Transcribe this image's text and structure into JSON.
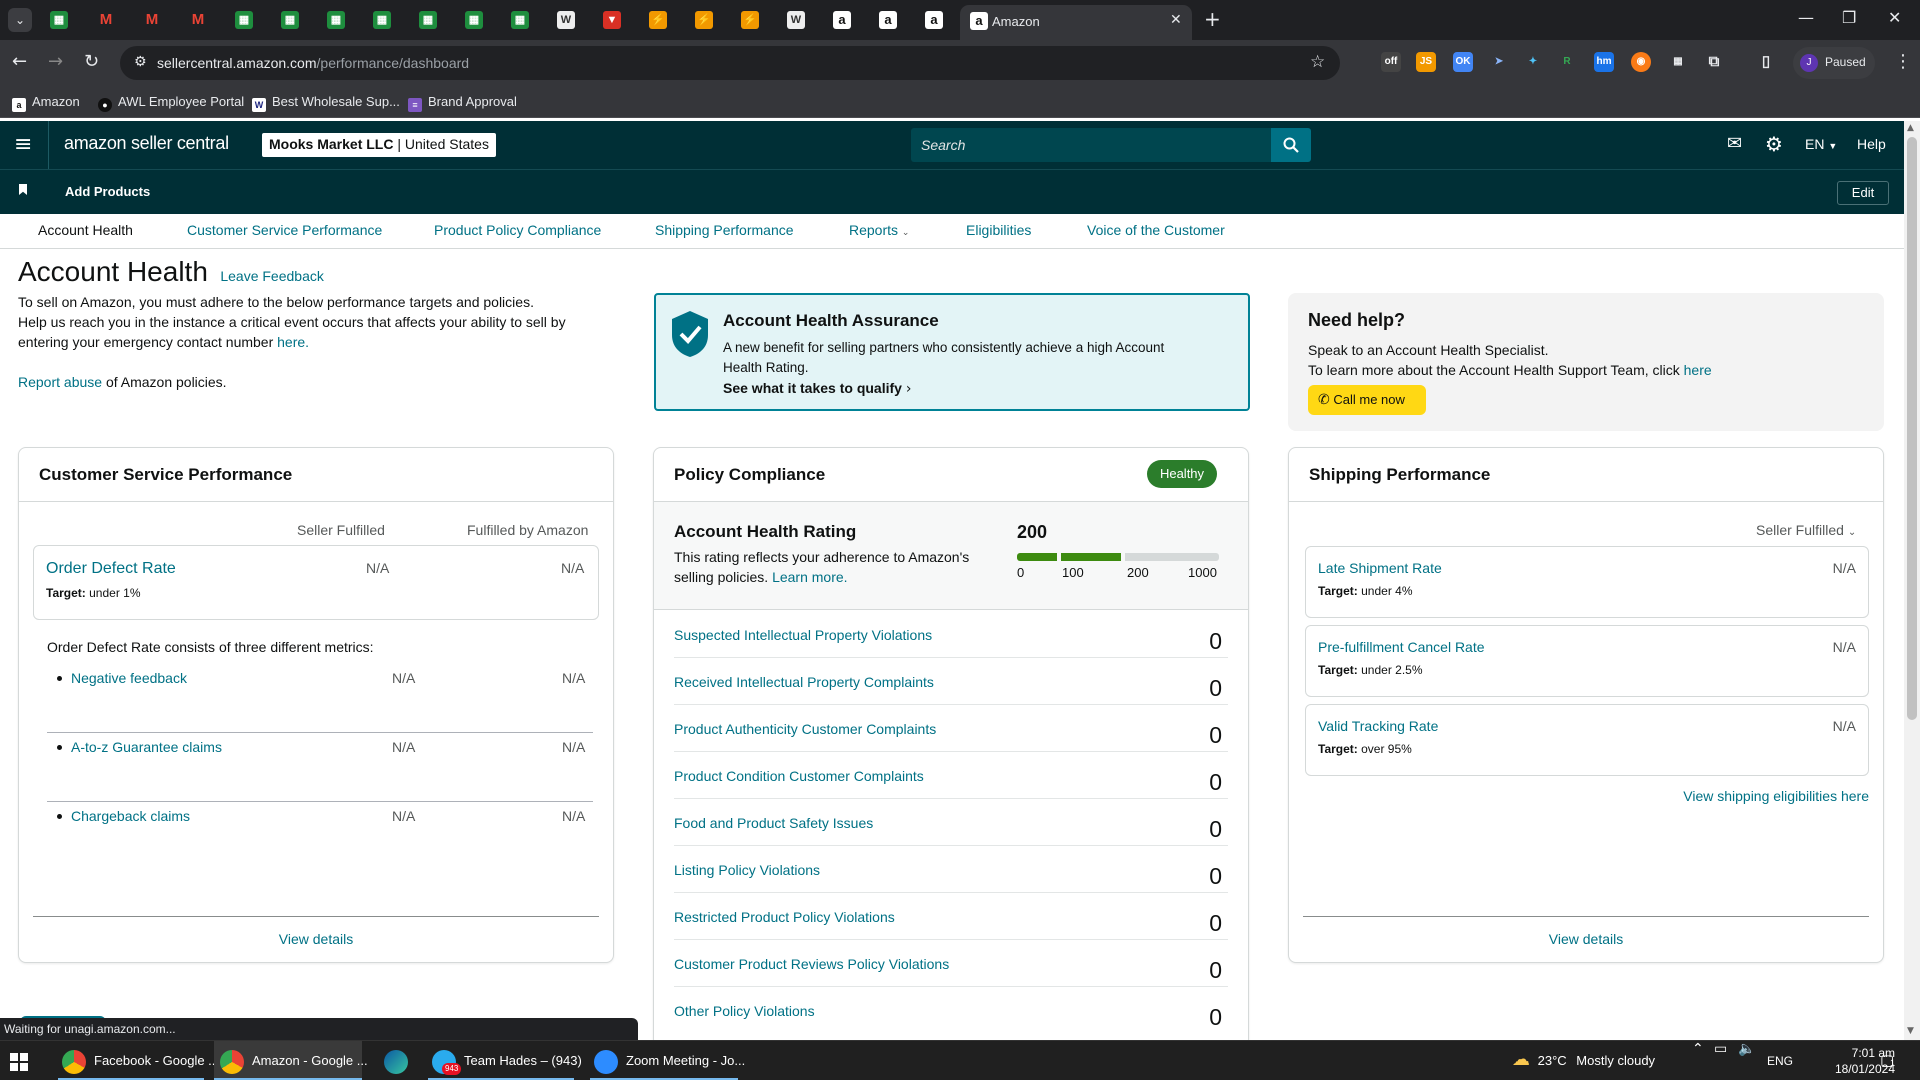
{
  "browser": {
    "active_tab_title": "Amazon",
    "url_host": "sellercentral.amazon.com",
    "url_path": "/performance/dashboard",
    "profile_status": "Paused",
    "profile_initial": "J",
    "tab_icons": [
      "sheets-icon",
      "gmail-icon",
      "gmail-icon",
      "gmail-icon",
      "sheets-icon",
      "sheets-icon",
      "sheets-icon",
      "sheets-icon",
      "sheets-icon",
      "sheets-icon",
      "sheets-icon",
      "doc-icon",
      "red-icon",
      "orange-icon",
      "orange-icon",
      "orange-icon",
      "wsj-icon",
      "amazon-icon",
      "amazon-icon",
      "amazon-icon"
    ],
    "bookmarks": [
      "Amazon",
      "AWL Employee Portal",
      "Best Wholesale Sup...",
      "Brand Approval"
    ],
    "status_text": "Waiting for unagi.amazon.com..."
  },
  "header": {
    "logo": "amazon seller central",
    "store_name": "Mooks Market LLC",
    "store_region": "United States",
    "search_placeholder": "Search",
    "lang": "EN",
    "help": "Help",
    "add_products": "Add Products",
    "edit": "Edit"
  },
  "subnav": [
    "Account Health",
    "Customer Service Performance",
    "Product Policy Compliance",
    "Shipping Performance",
    "Reports",
    "Eligibilities",
    "Voice of the Customer"
  ],
  "intro": {
    "title": "Account Health",
    "feedback": "Leave Feedback",
    "line1": "To sell on Amazon, you must adhere to the below performance targets and policies.",
    "line2": "Help us reach you in the instance a critical event occurs that affects your ability to sell by",
    "line3": "entering your emergency contact number",
    "here": "here.",
    "report_link": "Report abuse",
    "report_text": "of Amazon policies."
  },
  "assurance": {
    "title": "Account Health Assurance",
    "text1": "A new benefit for selling partners who consistently achieve a high Account",
    "text2": "Health Rating.",
    "cta": "See what it takes to qualify"
  },
  "help": {
    "title": "Need help?",
    "line1": "Speak to an Account Health Specialist.",
    "line2": "To learn more about the Account Health Support Team, click",
    "here": "here",
    "button": "Call me now"
  },
  "csp": {
    "title": "Customer Service Performance",
    "col1": "Seller Fulfilled",
    "col2": "Fulfilled by Amazon",
    "odr_label": "Order Defect Rate",
    "odr_target_label": "Target:",
    "odr_target": "under 1%",
    "odr_v1": "N/A",
    "odr_v2": "N/A",
    "consists": "Order Defect Rate consists of three different metrics:",
    "metrics": [
      {
        "label": "Negative feedback",
        "v1": "N/A",
        "v2": "N/A"
      },
      {
        "label": "A-to-z Guarantee claims",
        "v1": "N/A",
        "v2": "N/A"
      },
      {
        "label": "Chargeback claims",
        "v1": "N/A",
        "v2": "N/A"
      }
    ],
    "view_details": "View details"
  },
  "policy": {
    "title": "Policy Compliance",
    "badge": "Healthy",
    "ahr_title": "Account Health Rating",
    "ahr_desc1": "This rating reflects your adherence to Amazon's",
    "ahr_desc2": "selling policies.",
    "learn_more": "Learn more.",
    "rating": "200",
    "rating_value": 200,
    "scale": [
      "0",
      "100",
      "200",
      "1000"
    ],
    "rows": [
      {
        "label": "Suspected Intellectual Property Violations",
        "count": "0"
      },
      {
        "label": "Received Intellectual Property Complaints",
        "count": "0"
      },
      {
        "label": "Product Authenticity Customer Complaints",
        "count": "0"
      },
      {
        "label": "Product Condition Customer Complaints",
        "count": "0"
      },
      {
        "label": "Food and Product Safety Issues",
        "count": "0"
      },
      {
        "label": "Listing Policy Violations",
        "count": "0"
      },
      {
        "label": "Restricted Product Policy Violations",
        "count": "0"
      },
      {
        "label": "Customer Product Reviews Policy Violations",
        "count": "0"
      },
      {
        "label": "Other Policy Violations",
        "count": "0"
      }
    ]
  },
  "shipping": {
    "title": "Shipping Performance",
    "filter": "Seller Fulfilled",
    "metrics": [
      {
        "label": "Late Shipment Rate",
        "target_label": "Target:",
        "target": "under 4%",
        "value": "N/A"
      },
      {
        "label": "Pre-fulfillment Cancel Rate",
        "target_label": "Target:",
        "target": "under 2.5%",
        "value": "N/A"
      },
      {
        "label": "Valid Tracking Rate",
        "target_label": "Target:",
        "target": "over 95%",
        "value": "N/A"
      }
    ],
    "eligibilities_link": "View shipping eligibilities here",
    "view_details": "View details"
  },
  "taskbar": {
    "items": [
      "Facebook - Google ...",
      "Amazon - Google ...",
      "Team Hades – (943)",
      "Zoom Meeting - Jo..."
    ],
    "badge": "943",
    "weather_temp": "23°C",
    "weather_text": "Mostly cloudy",
    "lang": "ENG",
    "time": "7:01 am",
    "date": "18/01/2024",
    "notif_count": "1"
  }
}
